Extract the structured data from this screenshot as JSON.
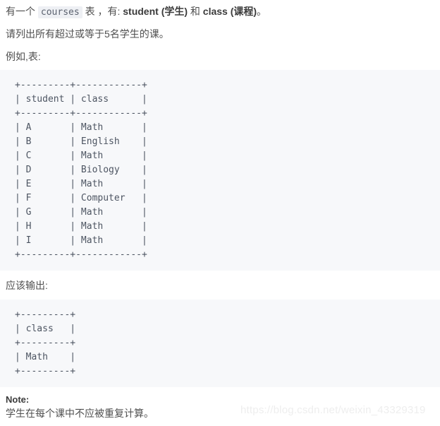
{
  "intro": {
    "prefix": "有一个 ",
    "table_name": "courses",
    "middle": " 表 ，有: ",
    "column_student": "student (学生)",
    "conjunction": " 和 ",
    "column_class": "class (课程)",
    "suffix": "。"
  },
  "question": "请列出所有超过或等于5名学生的课。",
  "example_label": "例如,表:",
  "output_label": "应该输出:",
  "courses_table": {
    "divider": "+---------+------------+",
    "header": "| student | class      |",
    "rows": [
      "| A       | Math       |",
      "| B       | English    |",
      "| C       | Math       |",
      "| D       | Biology    |",
      "| E       | Math       |",
      "| F       | Computer   |",
      "| G       | Math       |",
      "| H       | Math       |",
      "| I       | Math       |"
    ]
  },
  "output_table": {
    "divider": "+---------+",
    "header": "| class   |",
    "rows": [
      "| Math    |"
    ]
  },
  "note": {
    "title": "Note:",
    "body": "学生在每个课中不应被重复计算。"
  },
  "watermark": "https://blog.csdn.net/weixin_43329319",
  "colors": {
    "code_block_bg": "#f7f8fa",
    "inline_code_bg": "#eef0f4",
    "text": "#4f4f4f",
    "code_text": "#4d5562",
    "watermark": "#eeeeee"
  }
}
